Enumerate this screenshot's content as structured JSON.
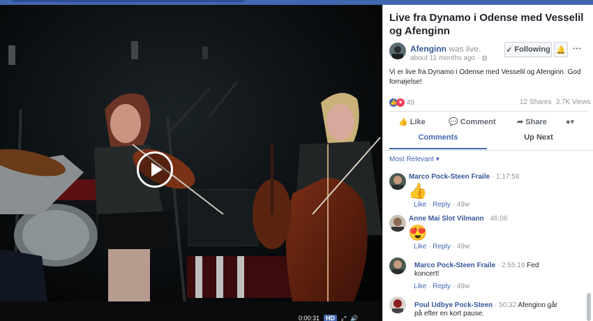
{
  "post": {
    "title": "Live fra Dynamo i Odense med Vesselil og Afenginn",
    "author": "Afenginn",
    "was_live": "was live.",
    "time": "about 11 months ago ·",
    "body": "Vi er live fra Dynamo i Odense med Vesselil og Afenginn. God fornøjelse!",
    "follow_label": "Following",
    "reaction_count": "49",
    "shares": "12 Shares",
    "views": "3.7K Views"
  },
  "actions": {
    "like": "Like",
    "comment": "Comment",
    "share": "Share"
  },
  "tabs": [
    {
      "label": "Comments"
    },
    {
      "label": "Up Next"
    }
  ],
  "sort_label": "Most Relevant",
  "comment_actions": {
    "like": "Like",
    "reply": "Reply",
    "sep": "·"
  },
  "comments": [
    {
      "author": "Marco Pock-Steen Fraile",
      "timestamp": "· 1:17:58",
      "emoji": "👍",
      "age": "49w"
    },
    {
      "author": "Anne Mai Slot Vilmann",
      "timestamp": "· 46:06",
      "emoji": "😍",
      "age": "49w"
    },
    {
      "author": "Marco Pock-Steen Fraile",
      "timestamp": "· 2:55:19",
      "text_a": "Fed",
      "text_b": "koncert!",
      "age": "49w"
    },
    {
      "author": "Poul Udbye Pock-Steen",
      "timestamp": "· 50:32",
      "text_a": "Afenginn går",
      "text_b": "på efter en kort pause."
    }
  ],
  "player": {
    "time": "0:00:31",
    "hd": "HD"
  },
  "colors": {
    "brand": "#4267b2",
    "link": "#365899",
    "muted": "#90949c",
    "love": "#f33e58"
  }
}
